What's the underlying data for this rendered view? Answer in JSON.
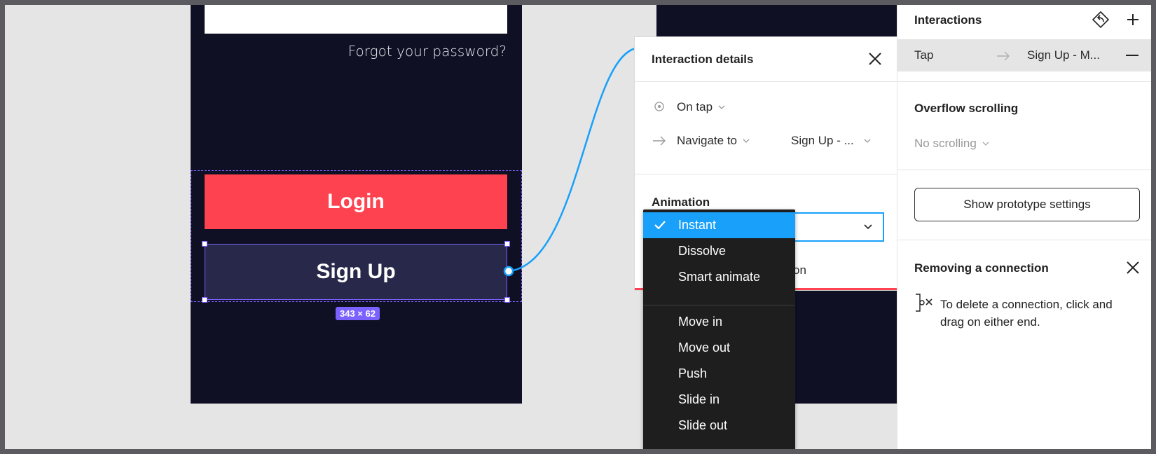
{
  "phone": {
    "forgot_link": "Forgot your password?",
    "login_label": "Login",
    "signup_label": "Sign Up",
    "size_badge": "343 × 62"
  },
  "interaction_details": {
    "title": "Interaction details",
    "trigger": "On tap",
    "action": "Navigate to",
    "destination": "Sign Up - ...",
    "animation_heading": "Animation",
    "obscured_text": "on"
  },
  "animation_dropdown": {
    "selected": "Instant",
    "group1": [
      "Instant",
      "Dissolve",
      "Smart animate"
    ],
    "group2": [
      "Move in",
      "Move out",
      "Push",
      "Slide in",
      "Slide out"
    ]
  },
  "right_panel": {
    "interactions_title": "Interactions",
    "tap_trigger": "Tap",
    "tap_destination": "Sign Up - M...",
    "overflow_title": "Overflow scrolling",
    "overflow_value": "No scrolling",
    "prototype_button": "Show prototype settings",
    "removing_title": "Removing a connection",
    "removing_text": "To delete a connection, click and drag on either end."
  },
  "colors": {
    "accent_blue": "#18a0fb",
    "brand_red": "#ff4250",
    "selection_purple": "#7b61ff",
    "dark_bg": "#0f1024"
  }
}
